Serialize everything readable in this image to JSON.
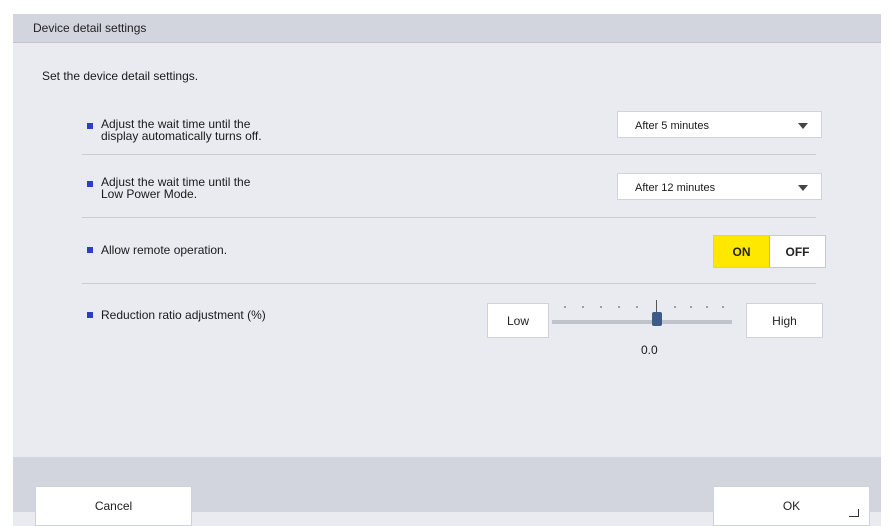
{
  "dialog": {
    "title": "Device detail settings",
    "intro": "Set the device detail settings."
  },
  "settings": {
    "display_off": {
      "line1": "Adjust the wait time until the",
      "line2": "display automatically turns off.",
      "value": "After 5 minutes"
    },
    "low_power": {
      "line1": "Adjust the wait time until the",
      "line2": "Low Power Mode.",
      "value": "After 12 minutes"
    },
    "remote": {
      "label": "Allow remote operation.",
      "on_label": "ON",
      "off_label": "OFF",
      "selected": "ON"
    },
    "reduction": {
      "label": "Reduction ratio adjustment (%)",
      "low_label": "Low",
      "high_label": "High",
      "value": "0.0",
      "level": 0.0
    }
  },
  "footer": {
    "cancel_label": "Cancel",
    "ok_label": "OK"
  },
  "colors": {
    "accent_bullet": "#2c3fc4",
    "toggle_on": "#ffe800",
    "slider_thumb": "#3e5a86"
  }
}
